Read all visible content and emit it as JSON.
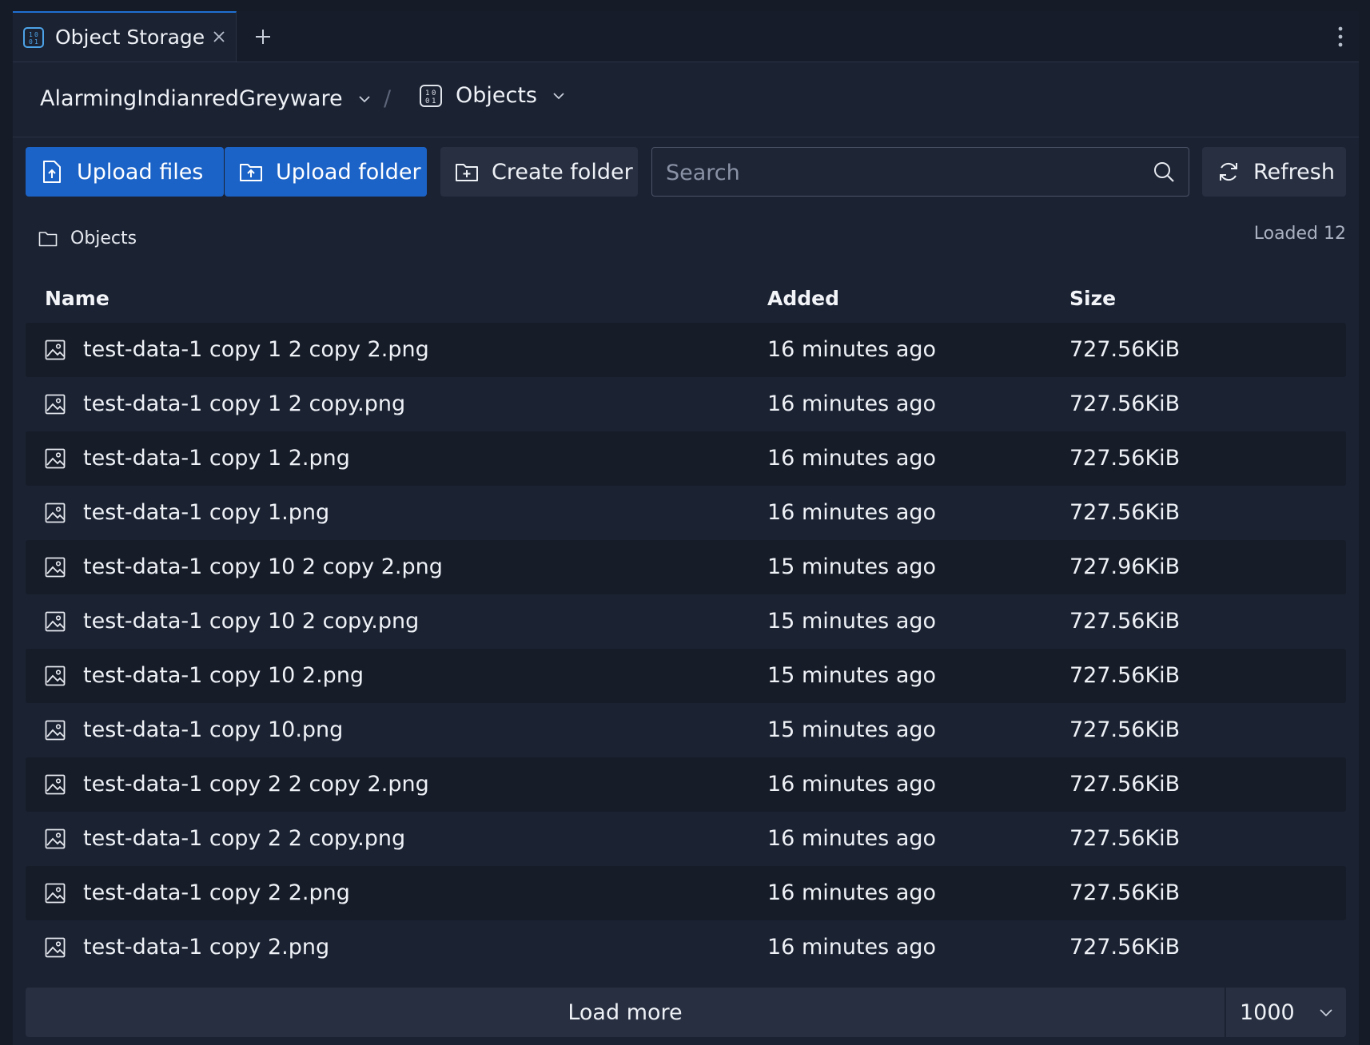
{
  "tab": {
    "title": "Object Storage",
    "icon": "binary-storage-icon"
  },
  "header": {
    "bucket_name": "AlarmingIndianredGreyware",
    "separator": "/",
    "section_label": "Objects"
  },
  "toolbar": {
    "upload_files_label": "Upload files",
    "upload_folder_label": "Upload folder",
    "create_folder_label": "Create folder",
    "search_placeholder": "Search",
    "refresh_label": "Refresh"
  },
  "path": {
    "current": "Objects"
  },
  "status": {
    "loaded": "Loaded 12"
  },
  "table": {
    "columns": {
      "name": "Name",
      "added": "Added",
      "size": "Size"
    },
    "rows": [
      {
        "name": "test-data-1 copy 1 2 copy 2.png",
        "added": "16 minutes ago",
        "size": "727.56KiB"
      },
      {
        "name": "test-data-1 copy 1 2 copy.png",
        "added": "16 minutes ago",
        "size": "727.56KiB"
      },
      {
        "name": "test-data-1 copy 1 2.png",
        "added": "16 minutes ago",
        "size": "727.56KiB"
      },
      {
        "name": "test-data-1 copy 1.png",
        "added": "16 minutes ago",
        "size": "727.56KiB"
      },
      {
        "name": "test-data-1 copy 10 2 copy 2.png",
        "added": "15 minutes ago",
        "size": "727.96KiB"
      },
      {
        "name": "test-data-1 copy 10 2 copy.png",
        "added": "15 minutes ago",
        "size": "727.56KiB"
      },
      {
        "name": "test-data-1 copy 10 2.png",
        "added": "15 minutes ago",
        "size": "727.56KiB"
      },
      {
        "name": "test-data-1 copy 10.png",
        "added": "15 minutes ago",
        "size": "727.56KiB"
      },
      {
        "name": "test-data-1 copy 2 2 copy 2.png",
        "added": "16 minutes ago",
        "size": "727.56KiB"
      },
      {
        "name": "test-data-1 copy 2 2 copy.png",
        "added": "16 minutes ago",
        "size": "727.56KiB"
      },
      {
        "name": "test-data-1 copy 2 2.png",
        "added": "16 minutes ago",
        "size": "727.56KiB"
      },
      {
        "name": "test-data-1 copy 2.png",
        "added": "16 minutes ago",
        "size": "727.56KiB"
      }
    ]
  },
  "footer": {
    "load_more_label": "Load more",
    "page_size": "1000"
  },
  "colors": {
    "primary_button": "#1c63c7",
    "active_tab_accent": "#1f6fd1",
    "background": "#1b2232"
  }
}
